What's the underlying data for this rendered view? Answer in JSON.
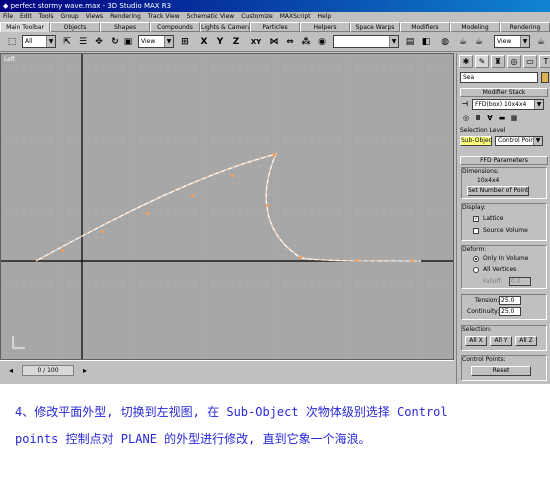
{
  "window": {
    "title": "perfect stormy wave.max - 3D Studio MAX R3"
  },
  "menu": [
    "File",
    "Edit",
    "Tools",
    "Group",
    "Views",
    "Rendering",
    "Track View",
    "Schematic View",
    "Customize",
    "MAXScript",
    "Help"
  ],
  "tabs": [
    "Main Toolbar",
    "Objects",
    "Shapes",
    "Compounds",
    "Lights & Cameras",
    "Particles",
    "Helpers",
    "Space Warps",
    "Modifiers",
    "Modeling",
    "Rendering"
  ],
  "toolbar": {
    "selection_filter": "All",
    "ref_coord": "View",
    "view_combo": "View",
    "axis_x": "X",
    "axis_y": "Y",
    "axis_z": "Z",
    "axis_xy": "XY"
  },
  "viewport": {
    "label": "Left"
  },
  "status": {
    "frame": "0 / 100"
  },
  "panel": {
    "object_name": "Sea",
    "modifier_stack_title": "Modifier Stack",
    "modifier_current": "FFD(box) 10x4x4",
    "selection_level_label": "Selection Level",
    "subobject_btn": "Sub-Object",
    "subobject_level": "Control Points",
    "ffd_params_title": "FFD Parameters",
    "dimensions_label": "Dimensions:",
    "dimensions_value": "10x4x4",
    "set_points_btn": "Set Number of Points",
    "display_label": "Display:",
    "lattice_label": "Lattice",
    "source_volume_label": "Source Volume",
    "deform_label": "Deform:",
    "only_in_volume": "Only In Volume",
    "all_vertices": "All Vertices",
    "falloff_label": "Falloff:",
    "falloff_value": "0.0",
    "tension_label": "Tension:",
    "tension_value": "25.0",
    "continuity_label": "Continuity:",
    "continuity_value": "25.0",
    "selection_label": "Selection:",
    "all_x": "All X",
    "all_y": "All Y",
    "all_z": "All Z",
    "control_points_label": "Control Points:",
    "reset_btn": "Reset"
  },
  "caption": {
    "line1": "4、修改平面外型, 切换到左视图, 在 Sub-Object 次物体级别选择 Control",
    "line2": "points 控制点对 PLANE 的外型进行修改, 直到它象一个海浪。"
  },
  "colors": {
    "caption": "#2828d8",
    "curve": "#f0a060",
    "title_bar": "#000080"
  }
}
